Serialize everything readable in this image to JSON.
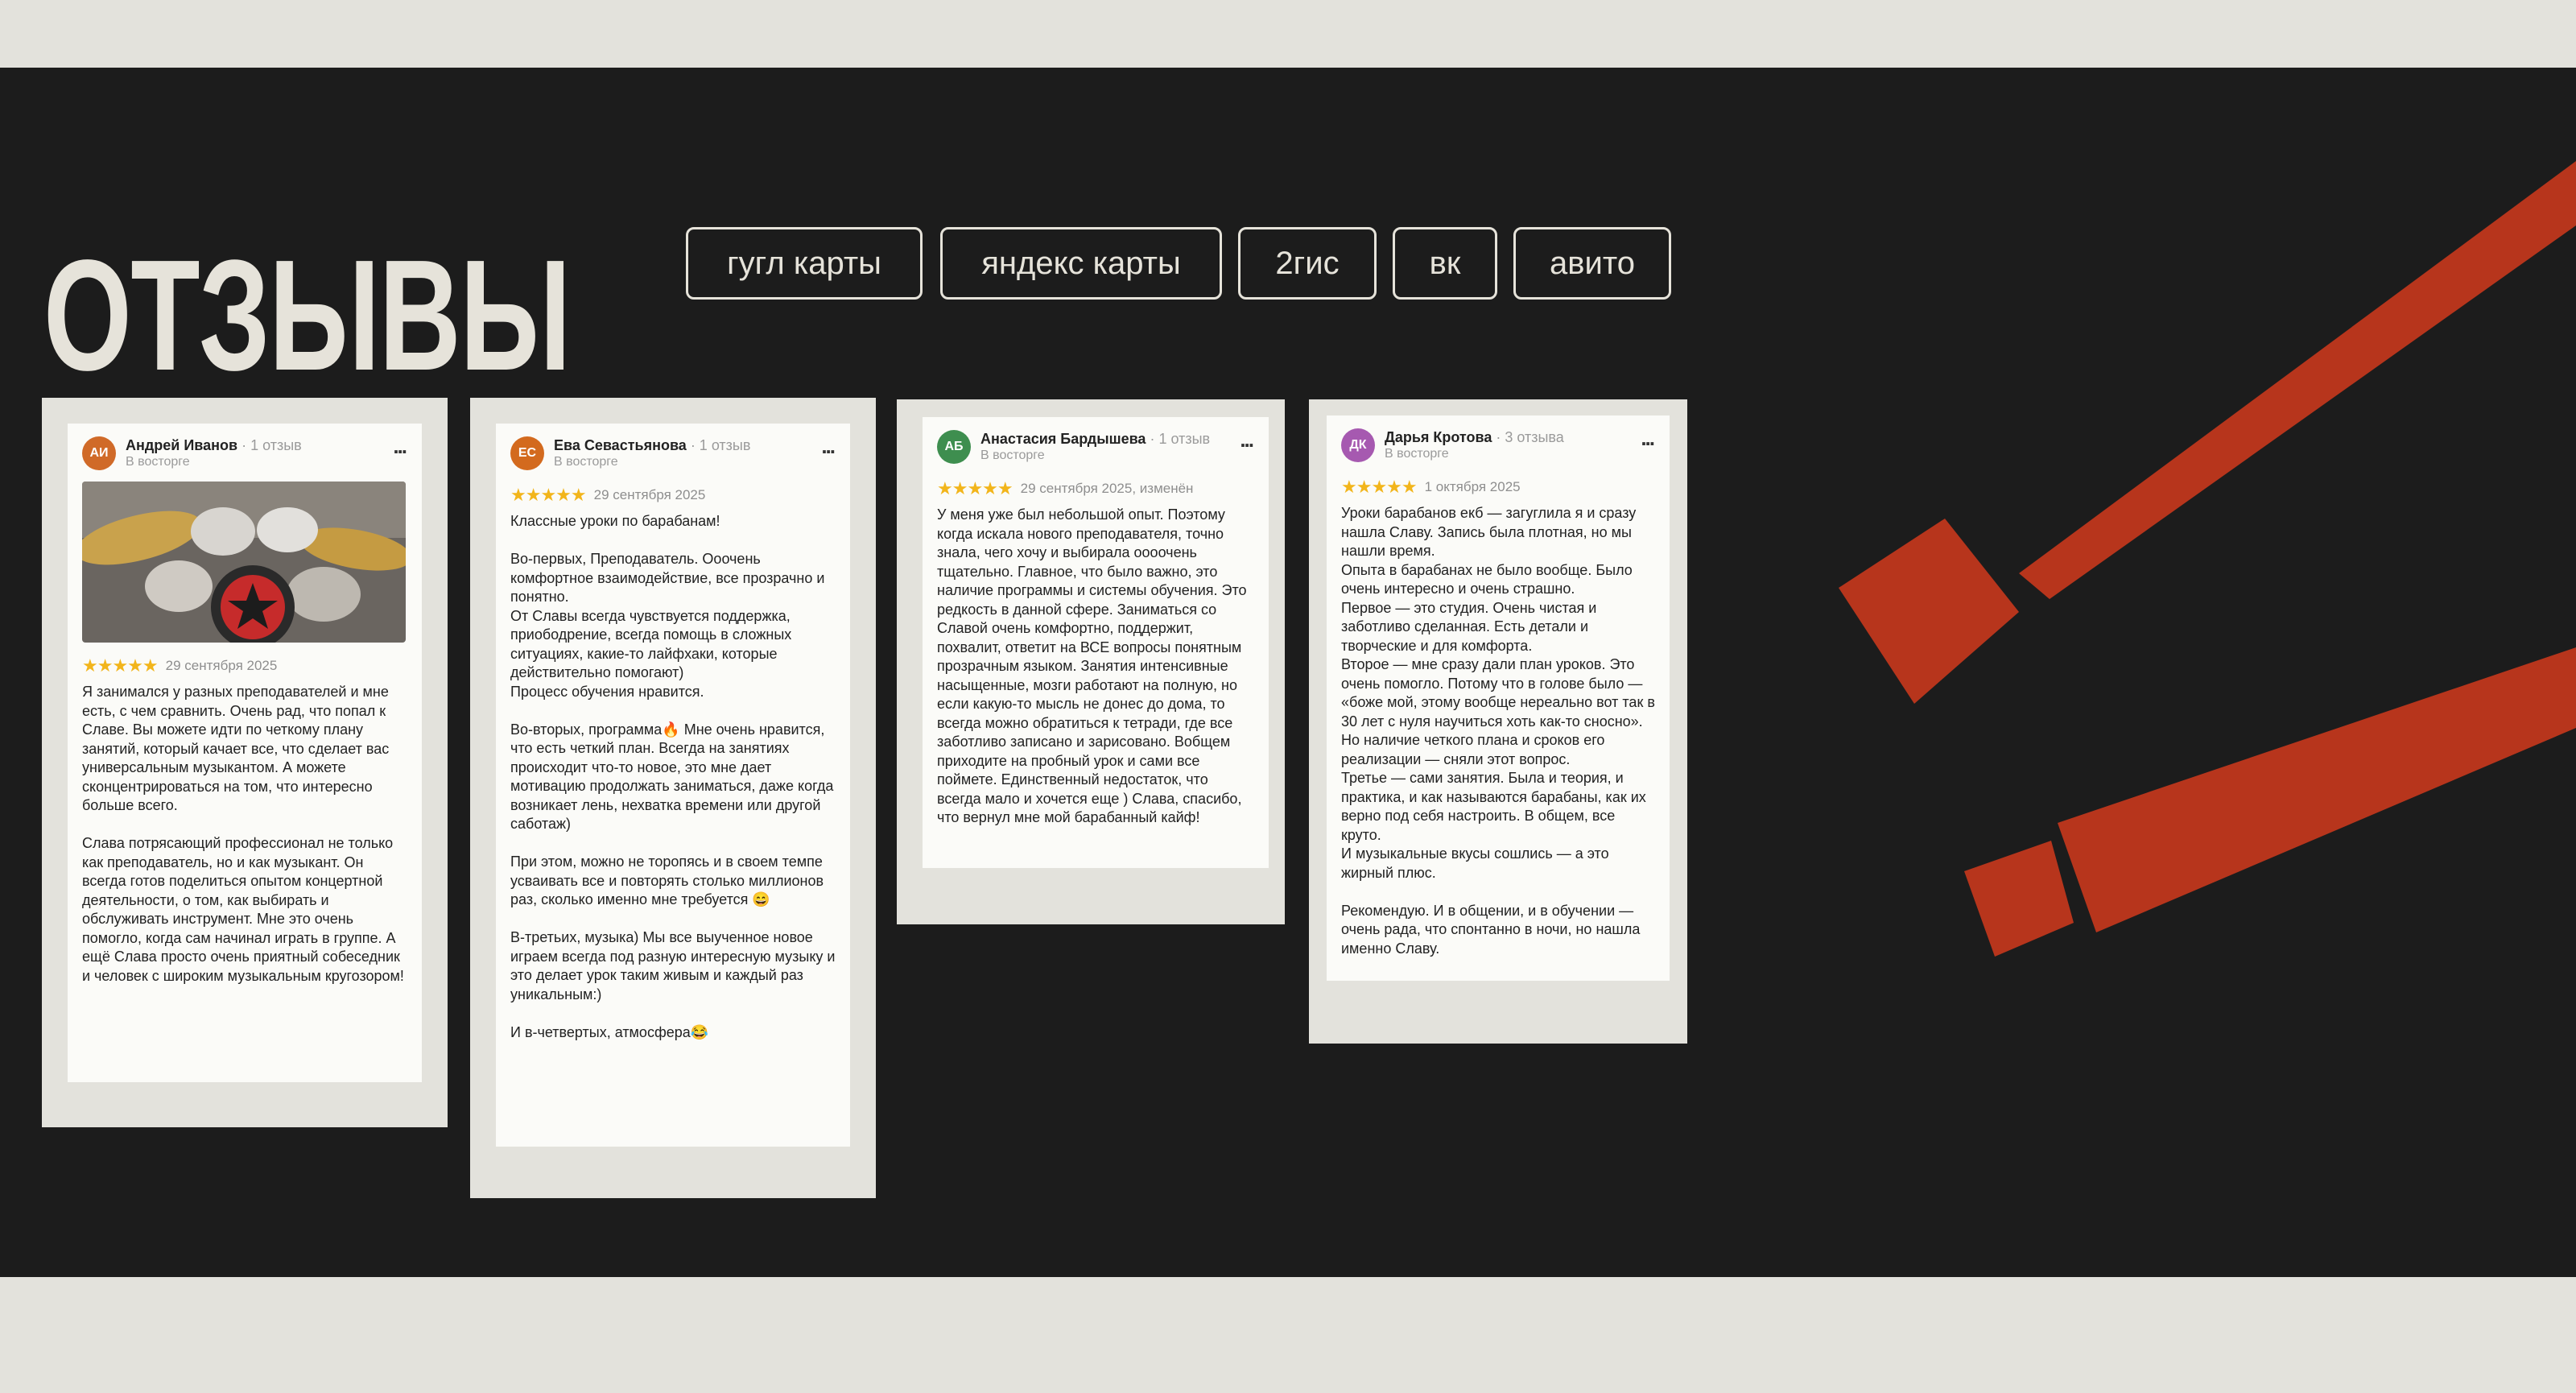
{
  "section": {
    "title": "ОТЗЫВЫ",
    "background": "#1c1c1c",
    "accent": "#b7351c",
    "text_color": "#e6e3da"
  },
  "platforms": [
    {
      "label": "гугл карты"
    },
    {
      "label": "яндекс карты"
    },
    {
      "label": "2гис"
    },
    {
      "label": "вк"
    },
    {
      "label": "авито"
    }
  ],
  "reviews": [
    {
      "initials": "АИ",
      "avatar_color": "#d06a28",
      "author": "Андрей Иванов",
      "review_count": "· 1 отзыв",
      "mood": "В восторге",
      "menu": "...",
      "stars": "★★★★★",
      "date": "29 сентября 2025",
      "photo": "drum-kit-photo",
      "text": "Я занимался у разных преподавателей и мне есть, с чем сравнить. Очень рад, что попал к Славе. Вы можете идти по четкому плану занятий, который качает все, что сделает вас универсальным музыкантом. А можете сконцентрироваться на том, что интересно больше всего.\n\nСлава потрясающий профессионал не только как преподаватель, но и как музыкант. Он всегда готов поделиться опытом концертной деятельности, о том, как выбирать и обслуживать инструмент. Мне это очень помогло, когда сам начинал играть в группе. А ещё Слава просто очень приятный собеседник и человек с широким музыкальным кругозором!"
    },
    {
      "initials": "ЕС",
      "avatar_color": "#d36a1e",
      "author": "Ева Севастьянова",
      "review_count": "· 1 отзыв",
      "mood": "В восторге",
      "menu": "...",
      "stars": "★★★★★",
      "date": "29 сентября 2025",
      "text": "Классные уроки по барабанам!\n\nВо-первых, Преподаватель. Ооочень комфортное взаимодействие, все прозрачно и понятно.\nОт Славы всегда чувствуется поддержка, приободрение, всегда помощь в сложных ситуациях, какие-то лайфхаки, которые действительно помогают)\nПроцесс обучения нравится.\n\nВо-вторых, программа🔥 Мне очень нравится, что есть четкий план. Всегда на занятиях происходит что-то новое, это мне дает мотивацию продолжать заниматься, даже когда возникает лень, нехватка времени или другой саботаж)\n\nПри этом, можно не торопясь и в своем темпе усваивать все и повторять столько миллионов раз, сколько именно мне требуется 😄\n\nВ-третьих, музыка) Мы все выученное новое играем всегда под разную интересную музыку и это делает урок таким живым и каждый раз уникальным:)\n\nИ в-четвертых, атмосфера😂"
    },
    {
      "initials": "АБ",
      "avatar_color": "#3e8e4f",
      "author": "Анастасия Бардышева",
      "review_count": "· 1 отзыв",
      "mood": "В восторге",
      "menu": "...",
      "stars": "★★★★★",
      "date": "29 сентября 2025, изменён",
      "text": "У меня уже был небольшой опыт. Поэтому когда искала нового преподавателя, точно знала, чего хочу и выбирала оооочень тщательно. Главное, что было важно, это наличие программы и системы обучения. Это редкость в данной сфере. Заниматься со Славой очень комфортно, поддержит, похвалит, ответит на ВСЕ вопросы понятным прозрачным языком. Занятия интенсивные насыщенные, мозги работают на полную, но если какую-то мысль не донес до дома, то всегда можно обратиться к тетради, где все заботливо записано и зарисовано. Вобщем приходите на пробный урок и сами все поймете. Единственный недостаток, что всегда мало и хочется еще ) Слава, спасибо, что вернул мне мой барабанный кайф!"
    },
    {
      "initials": "ДК",
      "avatar_color": "#a659b0",
      "author": "Дарья Кротова",
      "review_count": "· 3 отзыва",
      "mood": "В восторге",
      "menu": "...",
      "stars": "★★★★★",
      "date": "1 октября 2025",
      "text": "Уроки барабанов екб — загуглила я и сразу нашла Славу. Запись была плотная, но мы нашли время.\nОпыта в барабанах не было вообще. Было очень интересно и очень страшно.\nПервое — это студия. Очень чистая и заботливо сделанная. Есть детали и творческие и для комфорта.\nВторое — мне сразу дали план уроков. Это очень помогло. Потому что в голове было — «боже мой, этому вообще нереально вот так в 30 лет с нуля научиться хоть как-то сносно». Но наличие четкого плана и сроков его реализации — сняли этот вопрос.\nТретье — сами занятия. Была и теория, и практика, и как называются барабаны, как их верно под себя настроить. В общем, все круто.\nИ музыкальные вкусы сошлись — а это жирный плюс.\n\nРекомендую. И в общении, и в обучении — очень рада, что спонтанно в ночи, но нашла именно Славу."
    }
  ]
}
